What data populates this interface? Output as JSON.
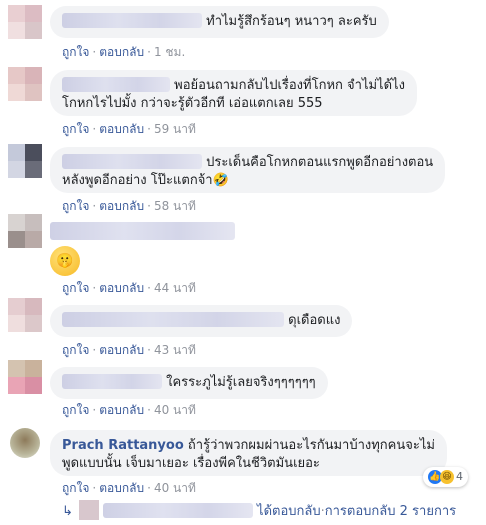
{
  "actions": {
    "like": "ถูกใจ",
    "reply": "ตอบกลับ",
    "separator": "·"
  },
  "comments": [
    {
      "text": "ทำไมรู้สึกร้อนๆ หนาวๆ ละครับ",
      "time": "1 ชม."
    },
    {
      "text_l1": "พอย้อนถามกลับไปเรื่องที่โกหก จำไม่ได้ไง",
      "text_l2": "โกหกไรไปมั้ง กว่าจะรู้ตัวอีกที เอ่อแตกเลย 555",
      "time": "59 นาที"
    },
    {
      "text_l1": "ประเด็นคือโกหกตอนแรกพูดอีกอย่างตอน",
      "text_l2": "หลังพูดอีกอย่าง โป๊ะแตกจ้า",
      "emoji": "🤣",
      "time": "58 นาที"
    },
    {
      "emoji": "🤫",
      "time": "44 นาที"
    },
    {
      "text": "ดุเดือดแง",
      "time": "43 นาที"
    },
    {
      "text": "ใครระภูไม่รู้เลยจริงๆๆๆๆๆๆ",
      "time": "40 นาที"
    },
    {
      "author": "Prach Rattanyoo",
      "text_l1": "ถ้ารู้ว่าพวกผมผ่านอะไรกันมาบ้างทุกคนจะไม่",
      "text_l2": "พูดแบบนั้น เจ็บมาเยอะ เรื่องพีคในชีวิตมันเยอะ",
      "reactions": {
        "count": "4",
        "icons": [
          "like-icon",
          "haha-icon"
        ]
      },
      "time": "40 นาที"
    }
  ],
  "reply_row": {
    "replied_label": "ได้ตอบกลับ",
    "count_label": "การตอบกลับ 2 รายการ"
  },
  "colors": {
    "link": "#385898",
    "meta": "#90949c",
    "bubble": "#f2f3f5",
    "like": "#2078f4"
  }
}
